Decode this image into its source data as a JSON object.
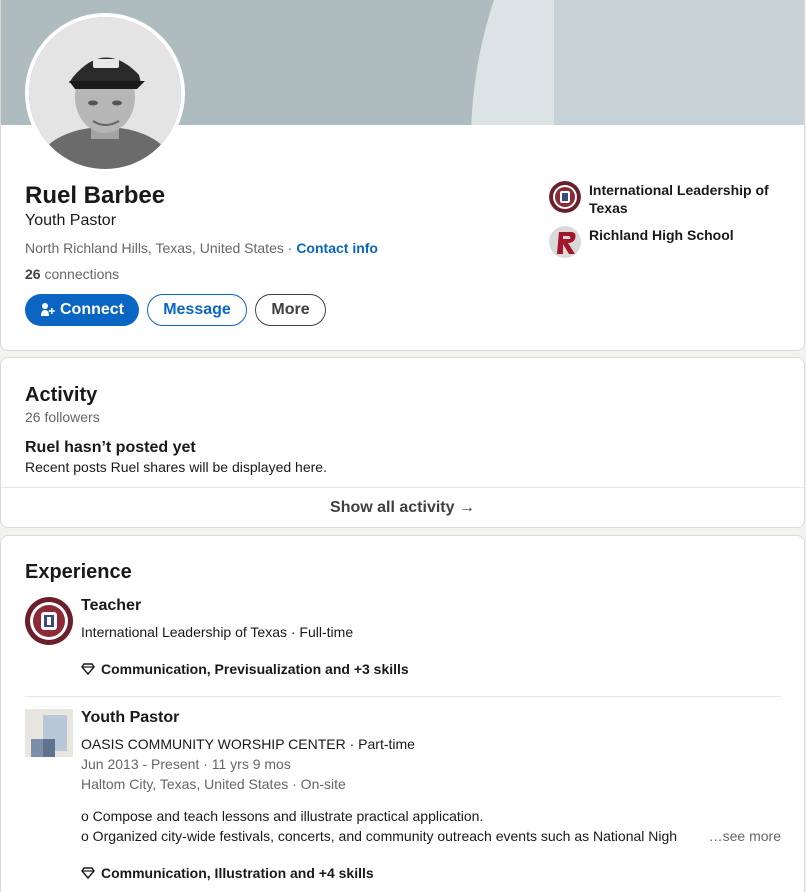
{
  "profile": {
    "name": "Ruel Barbee",
    "headline": "Youth Pastor",
    "location": "North Richland Hills, Texas, United States",
    "location_separator": " · ",
    "contact_info": "Contact info",
    "connections_count": "26",
    "connections_label": " connections",
    "buttons": {
      "connect": "Connect",
      "message": "Message",
      "more": "More"
    },
    "orgs": [
      {
        "name": "International Leadership of Texas",
        "icon": "ilt-logo"
      },
      {
        "name": "Richland High School",
        "icon": "richland-logo"
      }
    ]
  },
  "activity": {
    "title": "Activity",
    "followers": "26 followers",
    "empty_title": "Ruel hasn’t posted yet",
    "empty_sub": "Recent posts Ruel shares will be displayed here.",
    "show_all": "Show all activity →"
  },
  "experience": {
    "title": "Experience",
    "items": [
      {
        "title": "Teacher",
        "company": "International Leadership of Texas · Full-time",
        "skills": "Communication, Previsualization and +3 skills",
        "icon": "ilt-logo"
      },
      {
        "title": "Youth Pastor",
        "company": "OASIS COMMUNITY WORSHIP CENTER · Part-time",
        "dates": "Jun 2013 - Present · 11 yrs 9 mos",
        "place": "Haltom City, Texas, United States · On-site",
        "desc_1": "o Compose and teach lessons and illustrate practical application.",
        "desc_2": "o Organized city-wide festivals, concerts, and community outreach events such as National Nigh",
        "see_more": "…see more",
        "skills": "Communication, Illustration and +4 skills",
        "icon": "company-placeholder-icon"
      }
    ]
  },
  "colors": {
    "primary": "#0a66c2",
    "banner": "#aebcc0",
    "text": "#191919",
    "muted": "#666666"
  }
}
